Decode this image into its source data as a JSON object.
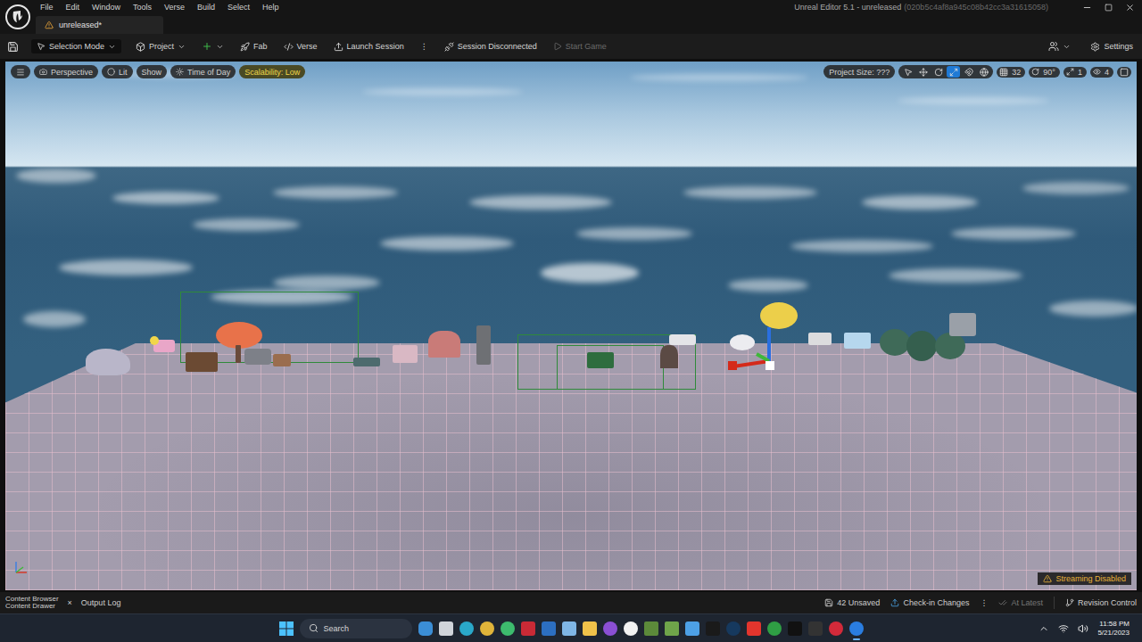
{
  "title_bar": {
    "menu": [
      "File",
      "Edit",
      "Window",
      "Tools",
      "Verse",
      "Build",
      "Select",
      "Help"
    ],
    "title": "Unreal Editor 5.1 - unreleased",
    "project_id": "(020b5c4af8a945c08b42cc3a31615058)"
  },
  "document_tab": {
    "label": "unreleased*",
    "selected": true
  },
  "toolbar": {
    "selection_mode": "Selection Mode",
    "project": "Project",
    "fab": "Fab",
    "verse": "Verse",
    "launch_session": "Launch Session",
    "more": "⋮",
    "session_status": "Session Disconnected",
    "start_game": {
      "label": "Start Game",
      "disabled": true
    },
    "settings": "Settings"
  },
  "viewport": {
    "left_buttons": [
      {
        "label": "Perspective",
        "highlighted": false
      },
      {
        "label": "Lit",
        "highlighted": false
      },
      {
        "label": "Show",
        "highlighted": false
      },
      {
        "label": "Time of Day",
        "highlighted": false
      },
      {
        "label": "Scalability: Low",
        "highlighted": true
      }
    ],
    "project_size": "Project Size: ???",
    "transform_tools": [
      {
        "kind": "select",
        "selected": false
      },
      {
        "kind": "translate",
        "selected": false
      },
      {
        "kind": "rotate",
        "selected": false
      },
      {
        "kind": "scale",
        "selected": true
      }
    ],
    "grid_snap": "32",
    "angle_snap": "90°",
    "scale_snap": "1",
    "camera_speed": "4",
    "streaming": "Streaming Disabled"
  },
  "status_bar": {
    "content_browser": "Content Browser",
    "content_drawer": "Content Drawer",
    "close": "×",
    "output_log": "Output Log",
    "unsaved": "42 Unsaved",
    "check_in": "Check-in Changes",
    "more": "⋮",
    "at_latest": {
      "label": "At Latest",
      "disabled": true
    },
    "revision_control": "Revision Control"
  },
  "taskbar": {
    "search": "Search",
    "time": "11:58 PM",
    "date": "5/21/2023"
  }
}
